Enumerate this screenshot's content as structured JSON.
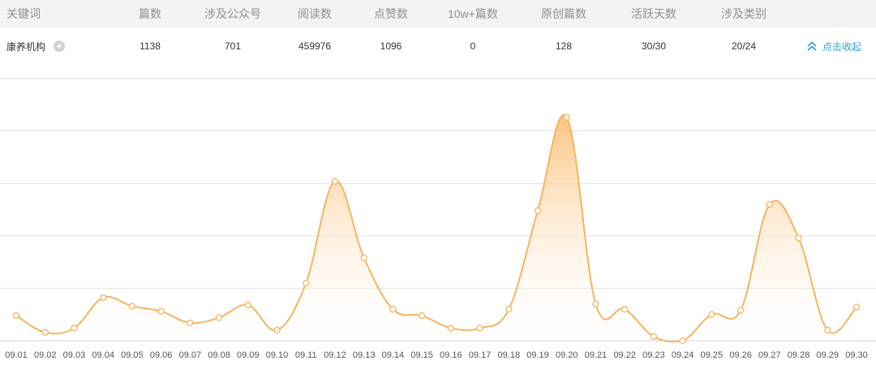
{
  "table": {
    "headers": [
      "关键词",
      "篇数",
      "涉及公众号",
      "阅读数",
      "点赞数",
      "10w+篇数",
      "原创篇数",
      "活跃天数",
      "涉及类别"
    ],
    "row": {
      "keyword": "康养机构",
      "values": [
        "1138",
        "701",
        "459976",
        "1096",
        "0",
        "128",
        "30/30",
        "20/24"
      ]
    },
    "collapse_label": "点击收起"
  },
  "icons": {
    "expand": "plus-circle-icon",
    "collapse": "double-chevron-up-icon"
  },
  "colors": {
    "line": "#f5b461",
    "fill_top": "#fbc07a",
    "link": "#2aa5d6",
    "header_bg": "#f3f3f3",
    "grid": "#e2e2e2"
  },
  "chart_data": {
    "type": "area",
    "categories": [
      "09.01",
      "09.02",
      "09.03",
      "09.04",
      "09.05",
      "09.06",
      "09.07",
      "09.08",
      "09.09",
      "09.10",
      "09.11",
      "09.12",
      "09.13",
      "09.14",
      "09.15",
      "09.16",
      "09.17",
      "09.18",
      "09.19",
      "09.20",
      "09.21",
      "09.22",
      "09.23",
      "09.24",
      "09.25",
      "09.26",
      "09.27",
      "09.28",
      "09.29",
      "09.30"
    ],
    "series": [
      {
        "values": [
          24,
          8,
          12,
          41,
          33,
          28,
          17,
          22,
          34,
          10,
          55,
          152,
          79,
          30,
          24,
          12,
          12,
          30,
          124,
          213,
          35,
          30,
          4,
          0,
          25,
          29,
          130,
          98,
          10,
          32
        ]
      }
    ],
    "ylim": [
      0,
      250
    ],
    "grid": true,
    "gridlines": 5
  }
}
